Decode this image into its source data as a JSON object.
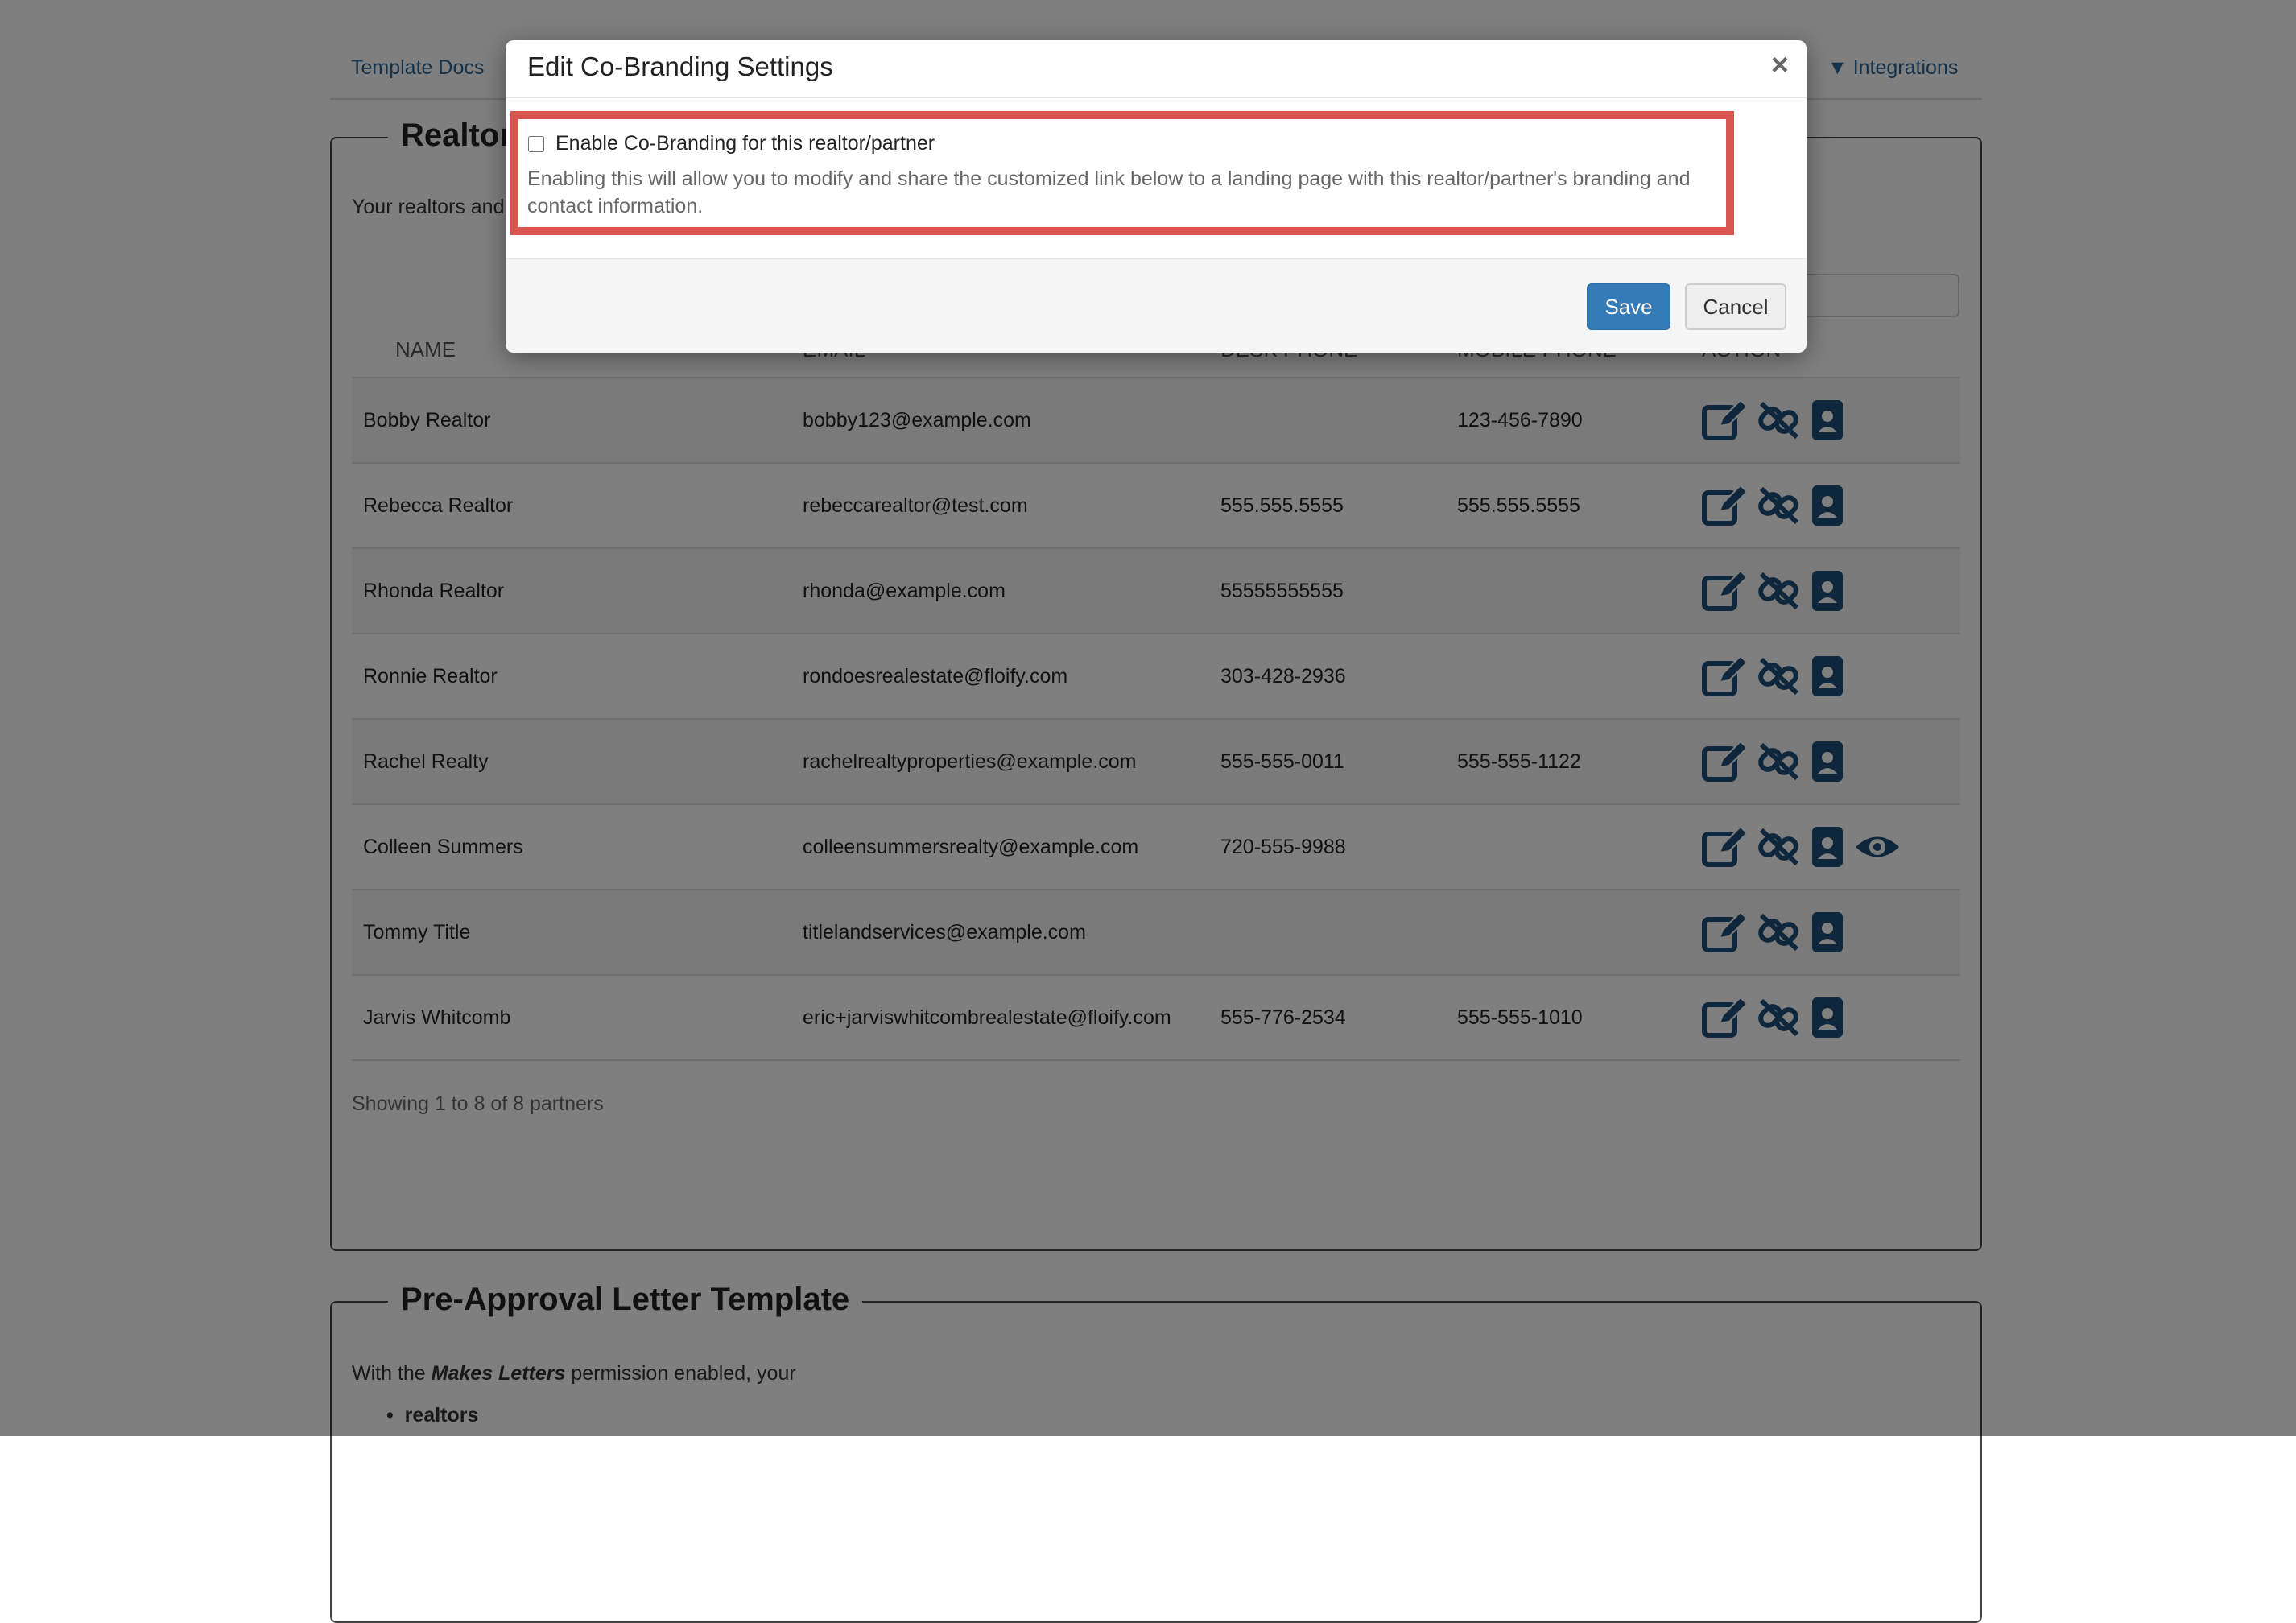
{
  "nav": {
    "template_docs": "Template Docs",
    "integrations": "Integrations"
  },
  "realtors": {
    "legend": "Realtors",
    "intro": "Your realtors and",
    "columns": [
      "NAME",
      "EMAIL",
      "DESK PHONE",
      "MOBILE PHONE",
      "ACTION"
    ],
    "rows": [
      {
        "name": "Bobby Realtor",
        "email": "bobby123@example.com",
        "desk": "",
        "mobile": "123-456-7890"
      },
      {
        "name": "Rebecca Realtor",
        "email": "rebeccarealtor@test.com",
        "desk": "555.555.5555",
        "mobile": "555.555.5555"
      },
      {
        "name": "Rhonda Realtor",
        "email": "rhonda@example.com",
        "desk": "55555555555",
        "mobile": ""
      },
      {
        "name": "Ronnie Realtor",
        "email": "rondoesrealestate@floify.com",
        "desk": "303-428-2936",
        "mobile": ""
      },
      {
        "name": "Rachel Realty",
        "email": "rachelrealtyproperties@example.com",
        "desk": "555-555-0011",
        "mobile": "555-555-1122"
      },
      {
        "name": "Colleen Summers",
        "email": "colleensummersrealty@example.com",
        "desk": "720-555-9988",
        "mobile": ""
      },
      {
        "name": "Tommy Title",
        "email": "titlelandservices@example.com",
        "desk": "",
        "mobile": ""
      },
      {
        "name": "Jarvis Whitcomb",
        "email": "eric+jarviswhitcombrealestate@floify.com",
        "desk": "555-776-2534",
        "mobile": "555-555-1010"
      }
    ],
    "preview_row": 5,
    "footer": "Showing 1 to 8 of 8 partners"
  },
  "preapproval": {
    "legend": "Pre-Approval Letter Template",
    "text_before": "With the ",
    "text_em": "Makes Letters",
    "text_after": " permission enabled, your",
    "bullet": "realtors"
  },
  "modal": {
    "title": "Edit Co-Branding Settings",
    "close": "×",
    "checkbox_label": "Enable Co-Branding for this realtor/partner",
    "help": "Enabling this will allow you to modify and share the customized link below to a landing page with this realtor/partner's branding and contact information.",
    "save": "Save",
    "cancel": "Cancel"
  },
  "colors": {
    "icon": "#1f4e79",
    "link": "#2a6496",
    "highlight": "#d9534f",
    "primary": "#337ab7"
  }
}
